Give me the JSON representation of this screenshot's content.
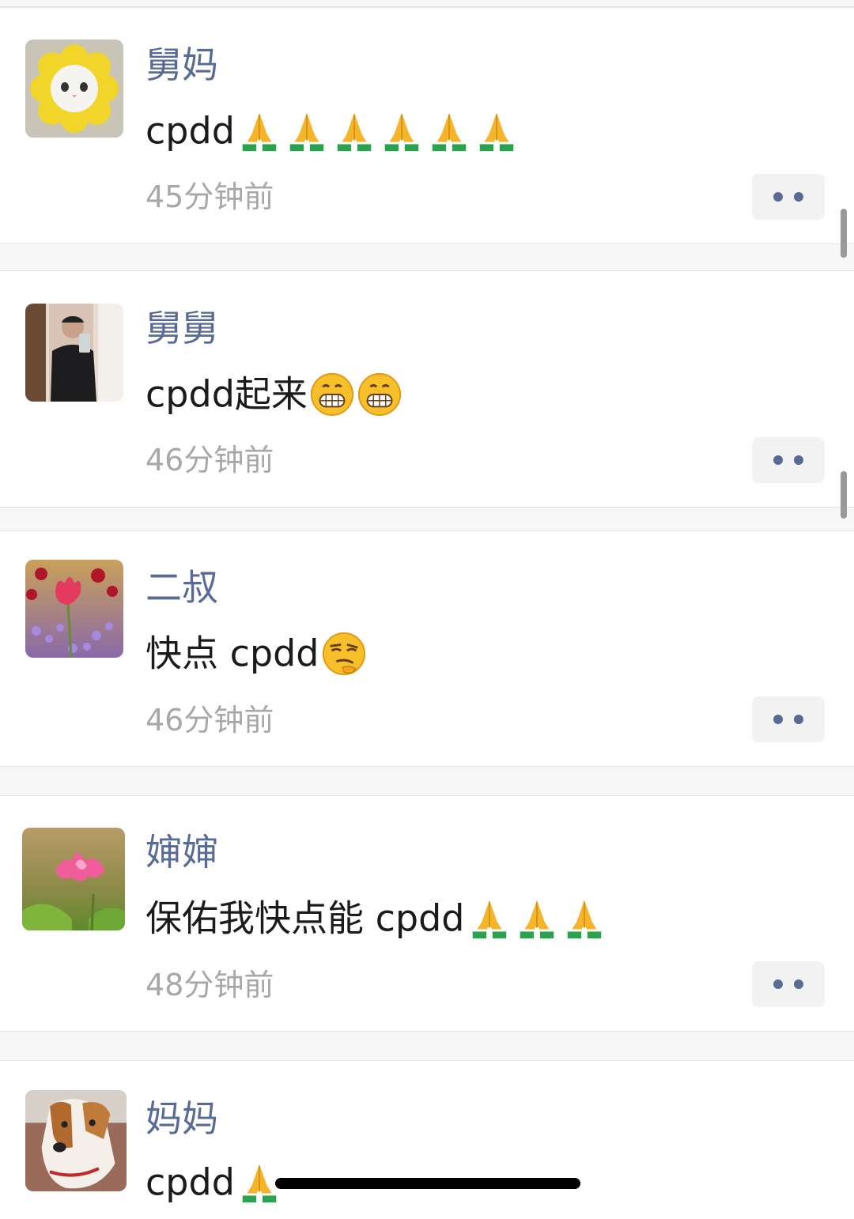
{
  "moments": [
    {
      "name": "舅妈",
      "text": "cpdd",
      "emojis": [
        "pray",
        "pray",
        "pray",
        "pray",
        "pray",
        "pray"
      ],
      "time": "45分钟前",
      "avatar": "cat-sunflower-avatar"
    },
    {
      "name": "舅舅",
      "text": "cpdd起来",
      "emojis": [
        "grimace",
        "grimace"
      ],
      "time": "46分钟前",
      "avatar": "man-selfie-avatar"
    },
    {
      "name": "二叔",
      "text": "快点 cpdd",
      "emojis": [
        "smirk-think"
      ],
      "time": "46分钟前",
      "avatar": "tulip-flower-avatar"
    },
    {
      "name": "婶婶",
      "text": "保佑我快点能 cpdd",
      "emojis": [
        "pray",
        "pray",
        "pray"
      ],
      "time": "48分钟前",
      "avatar": "lotus-flower-avatar"
    },
    {
      "name": "妈妈",
      "text": "cpdd",
      "emojis": [
        "pray"
      ],
      "time": "",
      "avatar": "dog-avatar"
    }
  ],
  "colors": {
    "name": "#586a96",
    "dots": "#576b95",
    "time": "#a8a8a8"
  }
}
